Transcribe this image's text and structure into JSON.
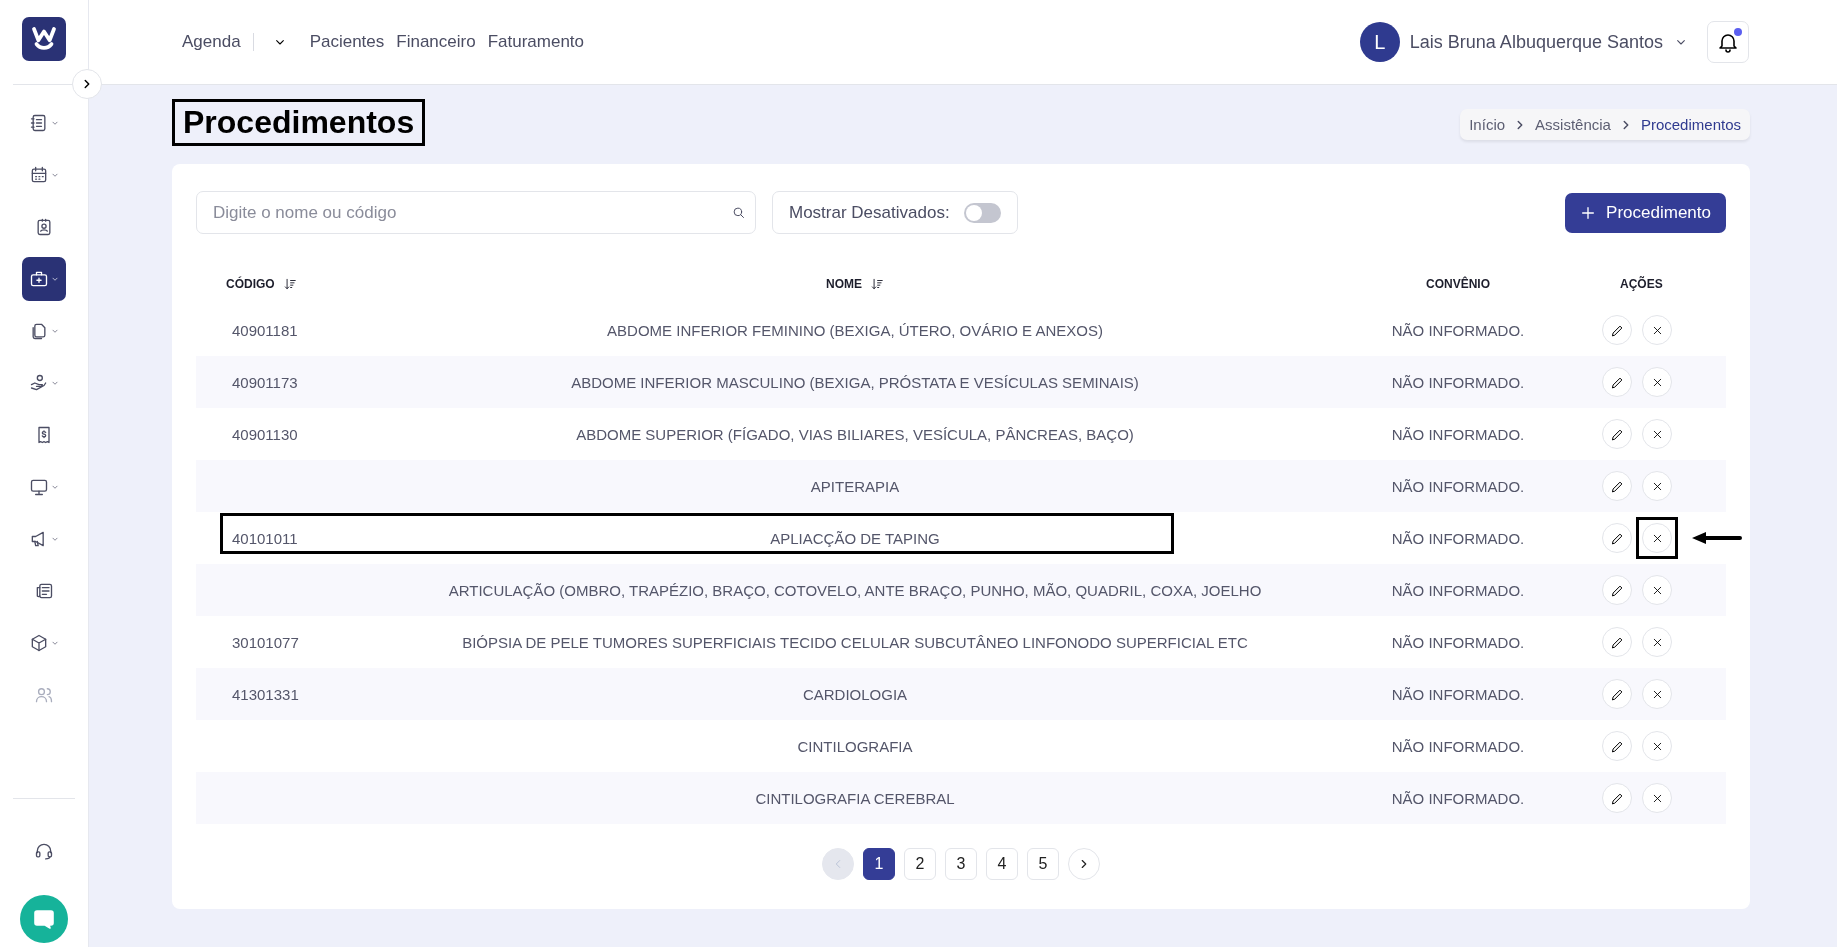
{
  "sidebar": {
    "items": [
      {
        "expandable": true,
        "selected": false,
        "disabled": false
      },
      {
        "expandable": true,
        "selected": false,
        "disabled": false
      },
      {
        "expandable": false,
        "selected": false,
        "disabled": false
      },
      {
        "expandable": true,
        "selected": true,
        "disabled": false
      },
      {
        "expandable": true,
        "selected": false,
        "disabled": false
      },
      {
        "expandable": true,
        "selected": false,
        "disabled": false
      },
      {
        "expandable": false,
        "selected": false,
        "disabled": false
      },
      {
        "expandable": true,
        "selected": false,
        "disabled": false
      },
      {
        "expandable": true,
        "selected": false,
        "disabled": false
      },
      {
        "expandable": false,
        "selected": false,
        "disabled": false
      },
      {
        "expandable": true,
        "selected": false,
        "disabled": false
      },
      {
        "expandable": false,
        "selected": false,
        "disabled": true
      }
    ]
  },
  "nav": [
    {
      "label": "Agenda",
      "dropdown": true
    },
    {
      "label": "Pacientes",
      "dropdown": false
    },
    {
      "label": "Financeiro",
      "dropdown": false
    },
    {
      "label": "Faturamento",
      "dropdown": false
    }
  ],
  "user": {
    "initial": "L",
    "name": "Lais Bruna Albuquerque Santos"
  },
  "notifications": {
    "unread": true
  },
  "page_title": {
    "text": "Procedimentos",
    "highlighted": true
  },
  "breadcrumb": [
    {
      "label": "Início",
      "current": false
    },
    {
      "label": "Assistência",
      "current": false
    },
    {
      "label": "Procedimentos",
      "current": true
    }
  ],
  "search": {
    "placeholder": "Digite o nome ou código"
  },
  "show_disabled": {
    "label": "Mostrar Desativados:",
    "on": false
  },
  "add_button": {
    "label": "Procedimento"
  },
  "table": {
    "columns": [
      {
        "label": "CÓDIGO",
        "sortable": true
      },
      {
        "label": "NOME",
        "sortable": true
      },
      {
        "label": "CONVÊNIO",
        "sortable": false
      },
      {
        "label": "AÇÕES",
        "sortable": false
      }
    ],
    "rows": [
      {
        "code": "40901181",
        "name": "ABDOME INFERIOR FEMININO (BEXIGA, ÚTERO, OVÁRIO E ANEXOS)",
        "insurance": "NÃO INFORMADO.",
        "highlighted": false,
        "delete_highlighted": false
      },
      {
        "code": "40901173",
        "name": "ABDOME INFERIOR MASCULINO (BEXIGA, PRÓSTATA E VESÍCULAS SEMINAIS)",
        "insurance": "NÃO INFORMADO.",
        "highlighted": false,
        "delete_highlighted": false
      },
      {
        "code": "40901130",
        "name": "ABDOME SUPERIOR (FÍGADO, VIAS BILIARES, VESÍCULA, PÂNCREAS, BAÇO)",
        "insurance": "NÃO INFORMADO.",
        "highlighted": false,
        "delete_highlighted": false
      },
      {
        "name": "APITERAPIA",
        "insurance": "NÃO INFORMADO.",
        "highlighted": false,
        "delete_highlighted": false
      },
      {
        "code": "40101011",
        "name": "APLIACÇÃO DE TAPING",
        "insurance": "NÃO INFORMADO.",
        "highlighted": true,
        "delete_highlighted": true
      },
      {
        "name": "ARTICULAÇÃO (OMBRO, TRAPÉZIO, BRAÇO, COTOVELO, ANTE BRAÇO, PUNHO, MÃO, QUADRIL, COXA, JOELHO",
        "insurance": "NÃO INFORMADO.",
        "highlighted": false,
        "delete_highlighted": false
      },
      {
        "code": "30101077",
        "name": "BIÓPSIA DE PELE TUMORES SUPERFICIAIS TECIDO CELULAR SUBCUTÂNEO LINFONODO SUPERFICIAL ETC",
        "insurance": "NÃO INFORMADO.",
        "highlighted": false,
        "delete_highlighted": false
      },
      {
        "code": "41301331",
        "name": "CARDIOLOGIA",
        "insurance": "NÃO INFORMADO.",
        "highlighted": false,
        "delete_highlighted": false
      },
      {
        "name": "CINTILOGRAFIA",
        "insurance": "NÃO INFORMADO.",
        "highlighted": false,
        "delete_highlighted": false
      },
      {
        "name": "CINTILOGRAFIA CEREBRAL",
        "insurance": "NÃO INFORMADO.",
        "highlighted": false,
        "delete_highlighted": false
      }
    ]
  },
  "pagination": {
    "previous_disabled": true,
    "pages": [
      {
        "label": "1",
        "selected": true
      },
      {
        "label": "2",
        "selected": false
      },
      {
        "label": "3",
        "selected": false
      },
      {
        "label": "4",
        "selected": false
      },
      {
        "label": "5",
        "selected": false
      }
    ]
  }
}
